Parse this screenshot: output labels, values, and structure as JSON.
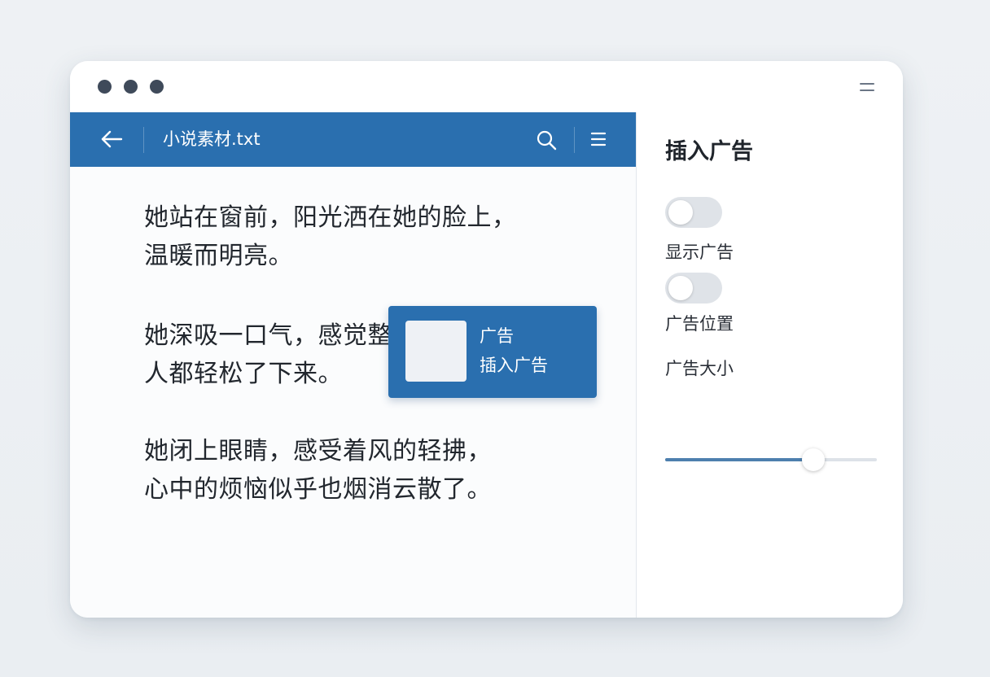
{
  "window": {
    "controls": [
      "dot-1",
      "dot-2",
      "dot-3"
    ],
    "menu_icon": "hamburger-icon"
  },
  "toolbar": {
    "back_icon": "arrow-left-icon",
    "title": "小说素材.txt",
    "search_icon": "search-icon",
    "menu_icon": "menu-icon"
  },
  "content": {
    "paragraphs": [
      [
        "她站在窗前，阳光洒在她的脸上，",
        "温暖而明亮。"
      ],
      [
        "她深吸一口气，感觉整",
        "人都轻松了下来。"
      ],
      [
        "她闭上眼睛，感受着风的轻拂，",
        "心中的烦恼似乎也烟消云散了。"
      ]
    ]
  },
  "ad": {
    "line1": "广告",
    "line2": "插入广告"
  },
  "panel": {
    "title": "插入广告",
    "toggle1": {
      "label": "显示广告",
      "on": false
    },
    "toggle2": {
      "label": "广告位置",
      "on": false
    },
    "slider": {
      "label": "广告大小",
      "value": 0.7
    }
  },
  "colors": {
    "accent": "#2a6faf",
    "toggle_off": "#dfe3e8",
    "slider_fill": "#4d7fae"
  }
}
